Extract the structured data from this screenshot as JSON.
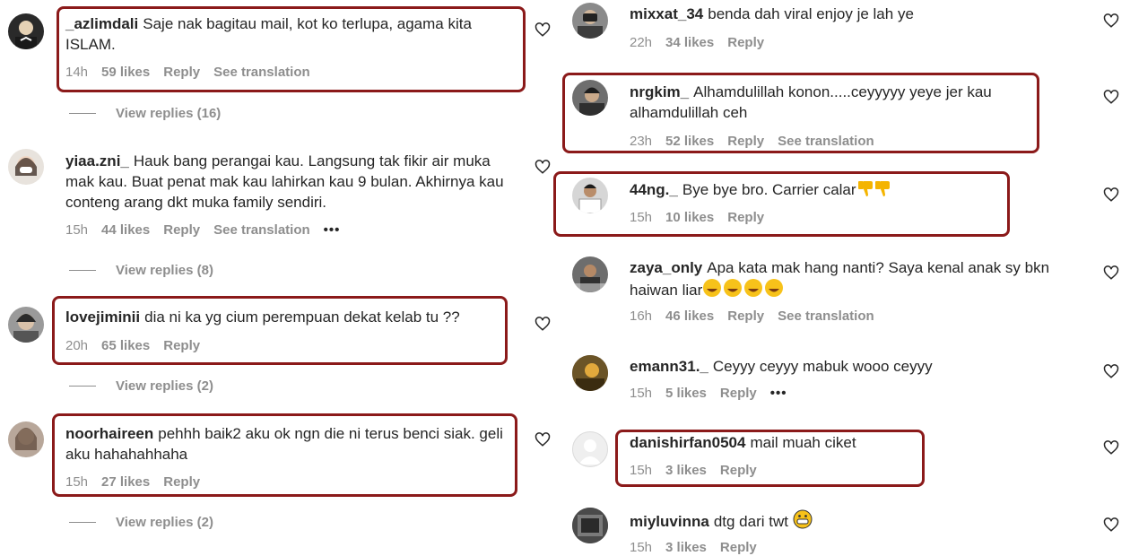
{
  "left": {
    "comments": [
      {
        "username": "_azlimdali",
        "text": "Saje nak bagitau mail, kot ko terlupa, agama kita ISLAM.",
        "time": "14h",
        "likes": "59 likes",
        "reply": "Reply",
        "translation": "See translation",
        "view_replies": "View replies (16)"
      },
      {
        "username": "yiaa.zni_",
        "text": "Hauk bang perangai kau. Langsung tak fikir air muka mak kau. Buat penat mak kau lahirkan kau 9 bulan. Akhirnya kau conteng arang dkt muka family sendiri.",
        "time": "15h",
        "likes": "44 likes",
        "reply": "Reply",
        "translation": "See translation",
        "more": "•••",
        "view_replies": "View replies (8)"
      },
      {
        "username": "lovejiminii",
        "text": "dia ni ka yg cium perempuan dekat kelab tu ??",
        "time": "20h",
        "likes": "65 likes",
        "reply": "Reply",
        "view_replies": "View replies (2)"
      },
      {
        "username": "noorhaireen",
        "text": "pehhh baik2 aku ok ngn die ni terus benci siak. geli aku hahahahhaha",
        "time": "15h",
        "likes": "27 likes",
        "reply": "Reply",
        "view_replies": "View replies (2)"
      }
    ]
  },
  "right": {
    "comments": [
      {
        "username": "mixxat_34",
        "text": "benda dah viral enjoy je lah ye",
        "time": "22h",
        "likes": "34 likes",
        "reply": "Reply"
      },
      {
        "username": "nrgkim_",
        "text": "Alhamdulillah konon.....ceyyyyy yeye jer kau alhamdulillah ceh",
        "time": "23h",
        "likes": "52 likes",
        "reply": "Reply",
        "translation": "See translation"
      },
      {
        "username": "44ng._",
        "text": "Bye bye bro. Carrier calar",
        "emoji": "thumbs-down-x2",
        "time": "15h",
        "likes": "10 likes",
        "reply": "Reply"
      },
      {
        "username": "zaya_only",
        "text": "Apa kata mak hang nanti? Saya kenal anak sy bkn haiwan liar",
        "emoji": "laughing-x4",
        "time": "16h",
        "likes": "46 likes",
        "reply": "Reply",
        "translation": "See translation"
      },
      {
        "username": "emann31._",
        "text": "Ceyyy ceyyy mabuk wooo ceyyy",
        "time": "15h",
        "likes": "5 likes",
        "reply": "Reply",
        "more": "•••"
      },
      {
        "username": "danishirfan0504",
        "text": "mail muah ciket",
        "time": "15h",
        "likes": "3 likes",
        "reply": "Reply"
      },
      {
        "username": "miyluvinna",
        "text": "dtg dari twt",
        "emoji": "grin-x1",
        "time": "15h",
        "likes": "3 likes",
        "reply": "Reply"
      }
    ]
  },
  "colors": {
    "highlight": "#8b1a1a",
    "meta": "#8e8e8e",
    "text": "#262626"
  }
}
